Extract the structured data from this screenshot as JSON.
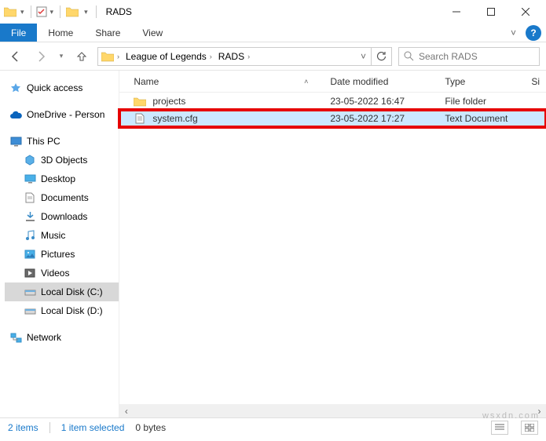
{
  "window": {
    "title": "RADS"
  },
  "menu": {
    "file": "File",
    "home": "Home",
    "share": "Share",
    "view": "View"
  },
  "breadcrumb": {
    "parent": "League of Legends",
    "current": "RADS"
  },
  "search": {
    "placeholder": "Search RADS"
  },
  "columns": {
    "name": "Name",
    "date": "Date modified",
    "type": "Type",
    "size": "Si"
  },
  "files": [
    {
      "name": "projects",
      "date": "23-05-2022 16:47",
      "type": "File folder"
    },
    {
      "name": "system.cfg",
      "date": "23-05-2022 17:27",
      "type": "Text Document"
    }
  ],
  "nav": {
    "quick": "Quick access",
    "onedrive": "OneDrive - Person",
    "thispc": "This PC",
    "objects3d": "3D Objects",
    "desktop": "Desktop",
    "documents": "Documents",
    "downloads": "Downloads",
    "music": "Music",
    "pictures": "Pictures",
    "videos": "Videos",
    "diskc": "Local Disk (C:)",
    "diskd": "Local Disk (D:)",
    "network": "Network"
  },
  "status": {
    "items": "2 items",
    "selected": "1 item selected",
    "size": "0 bytes"
  },
  "watermark": "wsxdn.com"
}
